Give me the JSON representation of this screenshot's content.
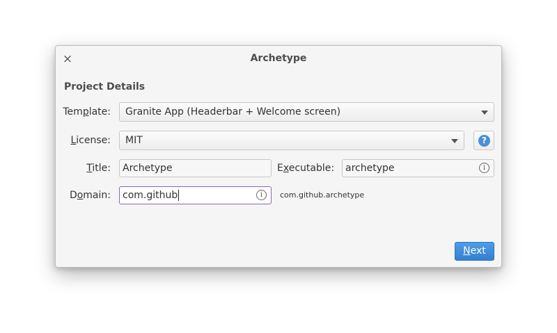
{
  "window": {
    "title": "Archetype",
    "close_glyph": "×"
  },
  "section_title": "Project Details",
  "template": {
    "label_pre": "Tem",
    "label_mnemonic": "p",
    "label_post": "late:",
    "value": "Granite App (Headerbar + Welcome screen)"
  },
  "license": {
    "label_mnemonic": "L",
    "label_post": "icense:",
    "value": "MIT",
    "help_glyph": "?"
  },
  "title_field": {
    "label_mnemonic": "T",
    "label_post": "itle:",
    "value": "Archetype"
  },
  "executable": {
    "label_pre": "E",
    "label_mnemonic": "x",
    "label_post": "ecutable:",
    "value": "archetype"
  },
  "domain": {
    "label_pre": "D",
    "label_mnemonic": "o",
    "label_post": "main:",
    "value": "com.github",
    "preview": "com.github.archetype"
  },
  "info_glyph": "i",
  "next": {
    "label_mnemonic": "N",
    "label_post": "ext"
  },
  "colors": {
    "accent": "#3a87d8",
    "focus": "#8d65b1",
    "background": "#f5f5f5"
  }
}
